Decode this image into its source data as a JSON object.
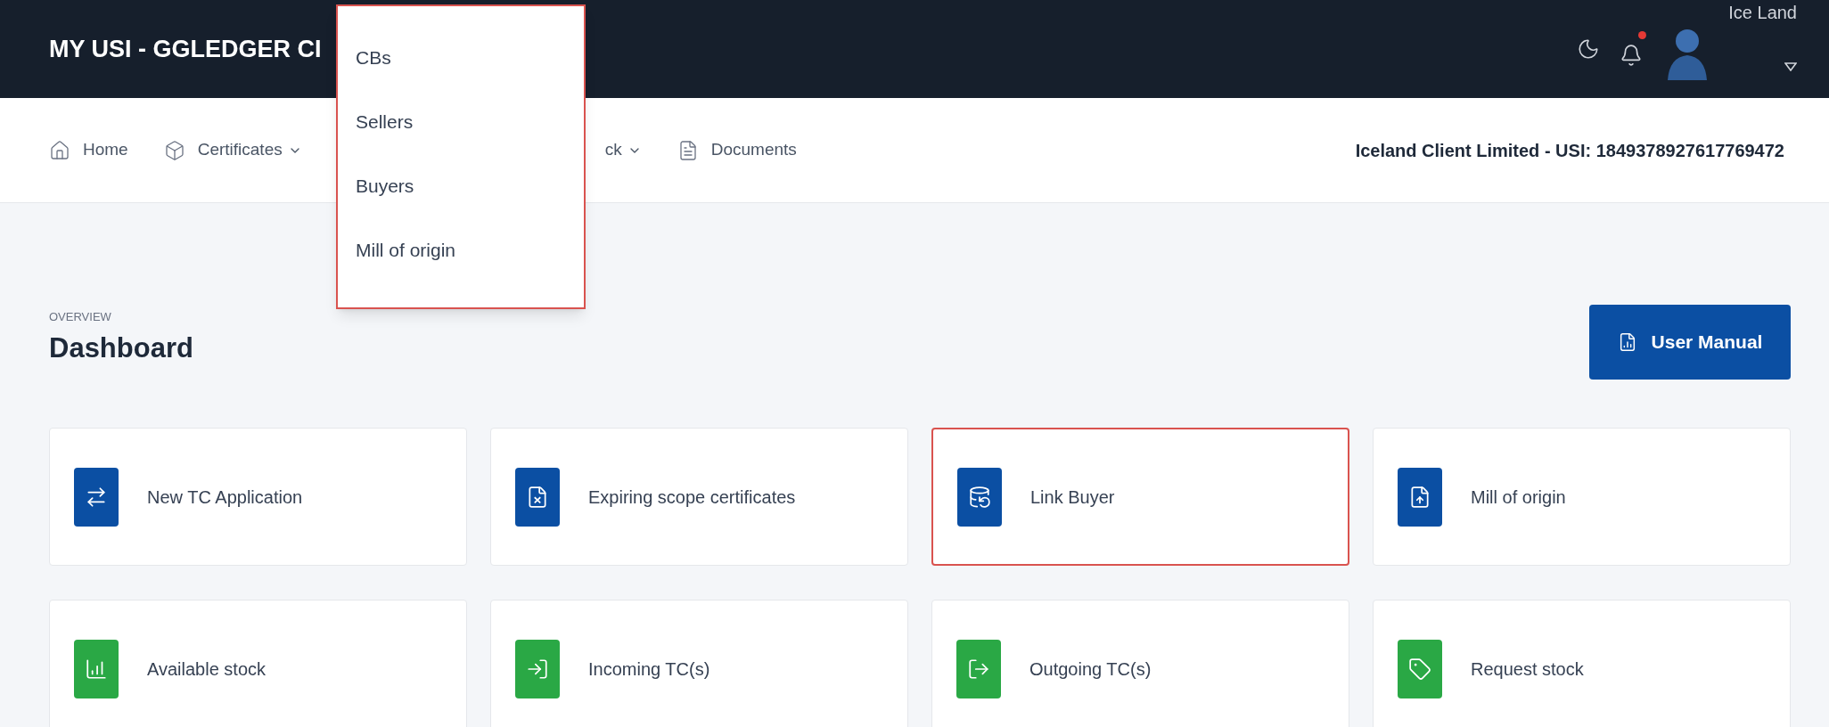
{
  "header": {
    "title": "MY USI - GGLEDGER CI",
    "user_name": "Ice Land",
    "notification_dot": true
  },
  "menu": {
    "highlighted": true,
    "items": [
      {
        "label": "CBs"
      },
      {
        "label": "Sellers"
      },
      {
        "label": "Buyers"
      },
      {
        "label": "Mill of origin"
      }
    ]
  },
  "nav": {
    "items": [
      {
        "label": "Home",
        "has_menu": false
      },
      {
        "label": "Certificates",
        "has_menu": true
      },
      {
        "label": "ck",
        "has_menu": true
      },
      {
        "label": "Documents",
        "has_menu": false
      }
    ],
    "client": "Iceland Client Limited - USI: 1849378927617769472"
  },
  "page": {
    "eyebrow": "OVERVIEW",
    "title": "Dashboard",
    "button": "User Manual"
  },
  "cards": [
    {
      "label": "New TC Application",
      "color": "#0b4fa3",
      "highlighted": false
    },
    {
      "label": "Expiring scope certificates",
      "color": "#0b4fa3",
      "highlighted": false
    },
    {
      "label": "Link Buyer",
      "color": "#0b4fa3",
      "highlighted": true
    },
    {
      "label": "Mill of origin",
      "color": "#0b4fa3",
      "highlighted": false
    },
    {
      "label": "Available stock",
      "color": "#2aa845",
      "highlighted": false
    },
    {
      "label": "Incoming TC(s)",
      "color": "#2aa845",
      "highlighted": false
    },
    {
      "label": "Outgoing TC(s)",
      "color": "#2aa845",
      "highlighted": false
    },
    {
      "label": "Request stock",
      "color": "#2aa845",
      "highlighted": false
    }
  ]
}
